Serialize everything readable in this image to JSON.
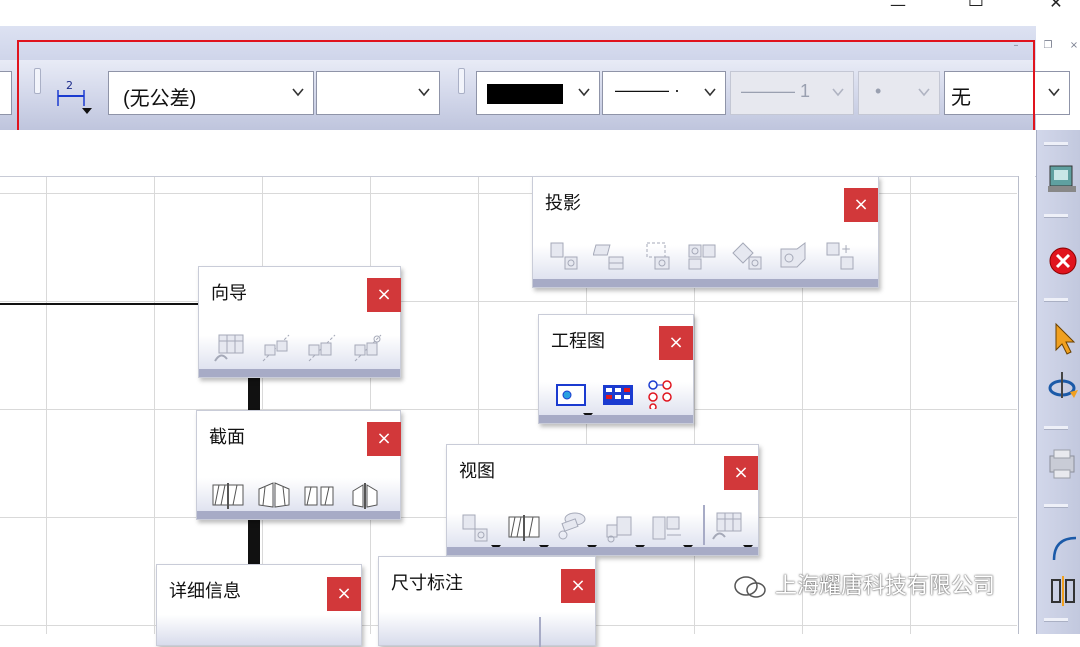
{
  "window": {
    "minimize_glyph": "—",
    "maximize_glyph": "☐",
    "close_glyph": "✕",
    "mdi_minimize_glyph": "–",
    "mdi_restore_glyph": "❐",
    "mdi_close_glyph": "×"
  },
  "toolbar": {
    "tolerance_combo": "(无公差)",
    "second_combo": "",
    "line_color_combo": "",
    "line_color": "#000000",
    "line_type_combo": "——— ·",
    "line_width_combo": "——— 1",
    "point_combo": "•",
    "fill_combo": "无"
  },
  "panels": {
    "projection": {
      "title": "投影",
      "close": "×"
    },
    "wizard": {
      "title": "向导",
      "close": "×"
    },
    "drawing": {
      "title": "工程图",
      "close": "×"
    },
    "section": {
      "title": "截面",
      "close": "×"
    },
    "view": {
      "title": "视图",
      "close": "×"
    },
    "detail": {
      "title": "详细信息",
      "close": "×"
    },
    "dimension": {
      "title": "尺寸标注",
      "close": "×"
    }
  },
  "watermark": {
    "text": "上海耀唐科技有限公司"
  },
  "icons": {
    "dimension_style": "dimension-style-icon",
    "wizard": [
      "table-wizard-icon",
      "mirror-view-icon",
      "mirror-view-2-icon",
      "mirror-view-3-icon"
    ],
    "projection": [
      "projection-view-icon",
      "auxiliary-view-icon",
      "clipping-view-icon",
      "front-view-icon",
      "isometric-view-icon",
      "3d-view-icon",
      "add-view-icon"
    ],
    "drawing": [
      "new-view-icon",
      "grid-layout-icon",
      "view-links-icon"
    ],
    "section": [
      "section-cut-icon",
      "aligned-section-icon",
      "section-view-icon",
      "offset-section-icon"
    ],
    "view": [
      "layout-view-icon",
      "section-tool-icon",
      "break-view-icon",
      "detail-view-icon",
      "clip-view-icon",
      "wizard-view-icon"
    ],
    "right_toolbar": [
      "catalog-icon",
      "stop-icon",
      "select-arrow-icon",
      "rotate-icon",
      "print-icon",
      "arc-icon",
      "symmetry-icon"
    ]
  },
  "colors": {
    "highlight": "#e0141e",
    "close_button": "#d2383a",
    "toolbar_top": "#e8ebf6",
    "toolbar_bottom": "#bfc5dd"
  }
}
